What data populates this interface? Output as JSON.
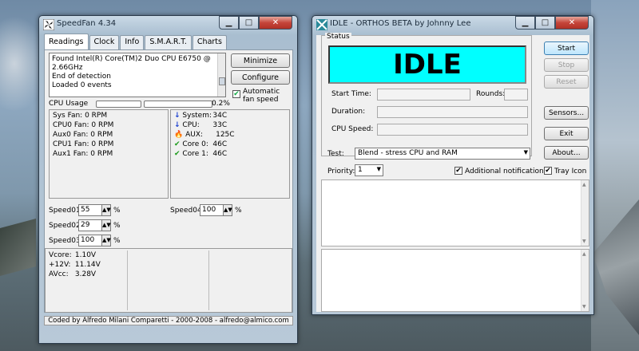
{
  "speedfan": {
    "title": "SpeedFan 4.34",
    "tabs": [
      "Readings",
      "Clock",
      "Info",
      "S.M.A.R.T.",
      "Charts"
    ],
    "log": [
      "Found Intel(R) Core(TM)2 Duo CPU E6750 @ 2.66GHz",
      "End of detection",
      "Loaded 0 events"
    ],
    "minimize_label": "Minimize",
    "configure_label": "Configure",
    "auto_fan_label": "Automatic fan speed",
    "cpu_usage_label": "CPU Usage",
    "cpu_usage_value": "0.2%",
    "fans": [
      "Sys Fan:",
      "CPU0 Fan:",
      "Aux0 Fan:",
      "CPU1 Fan:",
      "Aux1 Fan:"
    ],
    "fan_values": [
      "0 RPM",
      "0 RPM",
      "0 RPM",
      "0 RPM",
      "0 RPM"
    ],
    "temps": [
      {
        "name": "System:",
        "value": "34C",
        "icon": "arrow-down-icon"
      },
      {
        "name": "CPU:",
        "value": "33C",
        "icon": "arrow-down-icon"
      },
      {
        "name": "AUX:",
        "value": "125C",
        "icon": "flame-icon"
      },
      {
        "name": "Core 0:",
        "value": "46C",
        "icon": "check-icon"
      },
      {
        "name": "Core 1:",
        "value": "46C",
        "icon": "check-icon"
      }
    ],
    "speeds": [
      {
        "label": "Speed01:",
        "value": "55"
      },
      {
        "label": "Speed02:",
        "value": "29"
      },
      {
        "label": "Speed03:",
        "value": "100"
      },
      {
        "label": "Speed04:",
        "value": "100"
      }
    ],
    "percent": "%",
    "voltages": [
      {
        "name": "Vcore:",
        "value": "1.10V"
      },
      {
        "name": "+12V:",
        "value": "11.14V"
      },
      {
        "name": "AVcc:",
        "value": "3.28V"
      }
    ],
    "footer": "Coded by Alfredo Milani Comparetti - 2000-2008 - alfredo@almico.com"
  },
  "orthos": {
    "title": "IDLE - ORTHOS BETA by Johnny Lee",
    "status_label": "Status",
    "state": "IDLE",
    "start_time_label": "Start Time:",
    "rounds_label": "Rounds:",
    "duration_label": "Duration:",
    "cpu_speed_label": "CPU Speed:",
    "buttons": {
      "start": "Start",
      "stop": "Stop",
      "reset": "Reset",
      "sensors": "Sensors...",
      "exit": "Exit",
      "about": "About..."
    },
    "test_label": "Test:",
    "test_value": "Blend - stress CPU and RAM",
    "priority_label": "Priority:",
    "priority_value": "1",
    "additional_notification_label": "Additional notification",
    "tray_icon_label": "Tray Icon"
  },
  "colors": {
    "idle_bg": "#00ffff",
    "start_border": "#3c7fb1",
    "close_red": "#c5453a"
  }
}
